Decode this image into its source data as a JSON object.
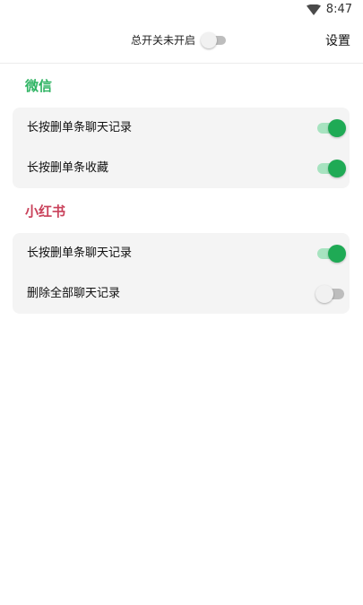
{
  "status_bar": {
    "time": "8:47",
    "wifi_icon": "wifi-icon"
  },
  "header": {
    "master_switch_label": "总开关未开启",
    "master_switch_on": false,
    "settings_label": "设置"
  },
  "sections": [
    {
      "title": "微信",
      "title_color": "#2fb463",
      "items": [
        {
          "label": "长按删单条聊天记录",
          "enabled": true
        },
        {
          "label": "长按删单条收藏",
          "enabled": true
        }
      ]
    },
    {
      "title": "小红书",
      "title_color": "#c9415a",
      "items": [
        {
          "label": "长按删单条聊天记录",
          "enabled": true
        },
        {
          "label": "删除全部聊天记录",
          "enabled": false
        }
      ]
    }
  ],
  "colors": {
    "toggle_on": "#1faa55",
    "toggle_on_track": "#a7e3c0",
    "toggle_off_track": "#bdbdbd",
    "card_background": "#f4f4f4"
  }
}
